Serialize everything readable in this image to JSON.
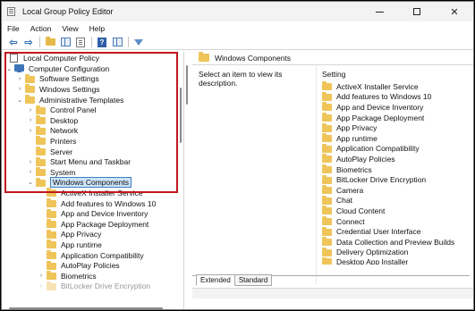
{
  "window": {
    "title": "Local Group Policy Editor"
  },
  "menu": [
    "File",
    "Action",
    "View",
    "Help"
  ],
  "toolbar": {
    "back": "back-arrow-icon",
    "forward": "forward-arrow-icon",
    "help_glyph": "?"
  },
  "tree": {
    "root": "Local Computer Policy",
    "items": [
      "Computer Configuration",
      "Software Settings",
      "Windows Settings",
      "Administrative Templates",
      "Control Panel",
      "Desktop",
      "Network",
      "Printers",
      "Server",
      "Start Menu and Taskbar",
      "System",
      "Windows Components",
      "ActiveX Installer Service",
      "Add features to Windows 10",
      "App and Device Inventory",
      "App Package Deployment",
      "App Privacy",
      "App runtime",
      "Application Compatibility",
      "AutoPlay Policies",
      "Biometrics",
      "BitLocker Drive Encryption"
    ]
  },
  "right": {
    "header": "Windows Components",
    "description": "Select an item to view its description.",
    "column": "Setting",
    "settings": [
      "ActiveX Installer Service",
      "Add features to Windows 10",
      "App and Device Inventory",
      "App Package Deployment",
      "App Privacy",
      "App runtime",
      "Application Compatibility",
      "AutoPlay Policies",
      "Biometrics",
      "BitLocker Drive Encryption",
      "Camera",
      "Chat",
      "Cloud Content",
      "Connect",
      "Credential User Interface",
      "Data Collection and Preview Builds",
      "Delivery Optimization",
      "Desktop App Installer"
    ],
    "tabs": [
      "Extended",
      "Standard"
    ]
  },
  "colors": {
    "highlight": "#c0171f",
    "selection": "#cce4f7",
    "folder": "#efc55a"
  }
}
